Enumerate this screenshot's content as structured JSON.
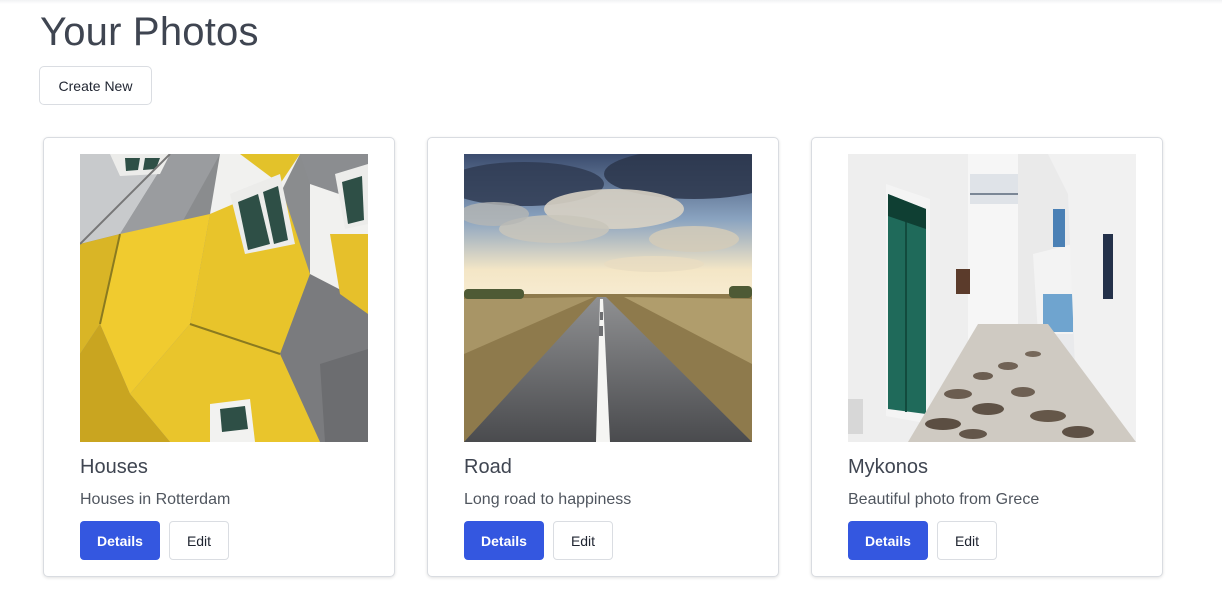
{
  "page": {
    "title": "Your Photos",
    "create_label": "Create New"
  },
  "photos": [
    {
      "title": "Houses",
      "description": "Houses in Rotterdam",
      "details_label": "Details",
      "edit_label": "Edit"
    },
    {
      "title": "Road",
      "description": "Long road to happiness",
      "details_label": "Details",
      "edit_label": "Edit"
    },
    {
      "title": "Mykonos",
      "description": "Beautiful photo from Grece",
      "details_label": "Details",
      "edit_label": "Edit"
    }
  ],
  "colors": {
    "primary": "#3457e0",
    "text": "#3f4551",
    "border": "#d9dce1"
  }
}
